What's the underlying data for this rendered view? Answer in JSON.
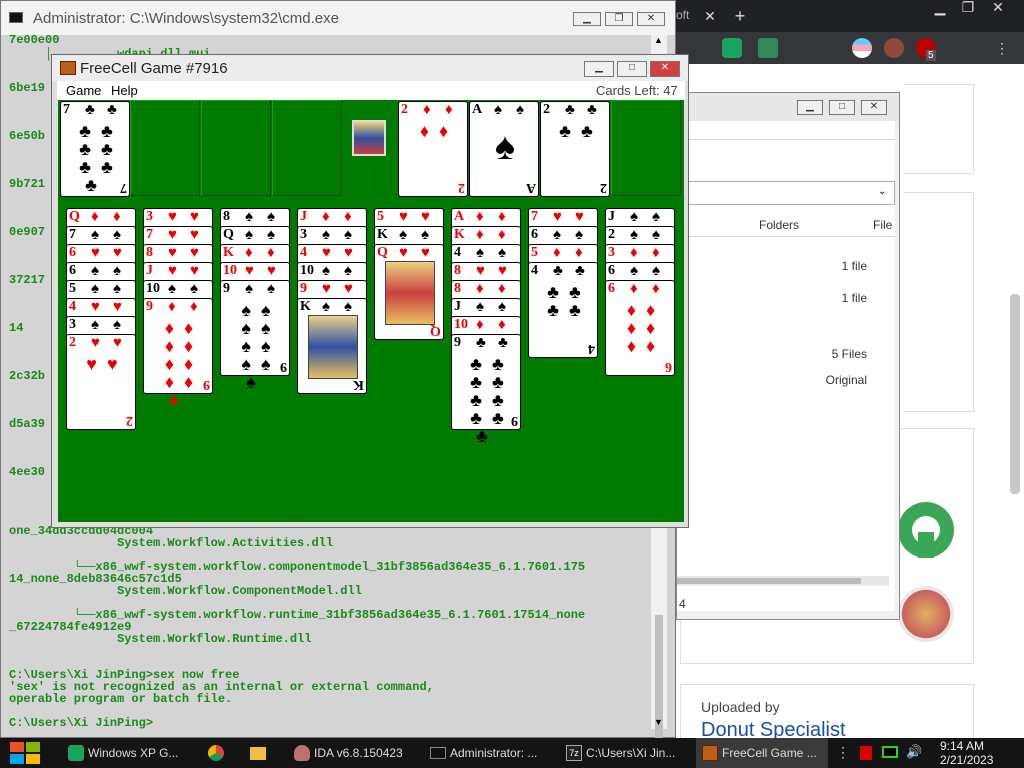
{
  "cmd": {
    "title": "Administrator: C:\\Windows\\system32\\cmd.exe",
    "left_fragments": [
      "7e00e00",
      "6be19",
      "6e50b",
      "9b721",
      "0e907",
      "37217",
      "14",
      "2c32b",
      "d5a39",
      "4ee30"
    ],
    "top_fragment": "     │         wdapi.dll.mui",
    "bottom_lines": [
      "one_34dd3ccdd04dc004",
      "               System.Workflow.Activities.dll",
      "",
      "         └──x86_wwf-system.workflow.componentmodel_31bf3856ad364e35_6.1.7601.175",
      "14_none_8deb83646c57c1d5",
      "               System.Workflow.ComponentModel.dll",
      "",
      "         └──x86_wwf-system.workflow.runtime_31bf3856ad364e35_6.1.7601.17514_none",
      "_67224784fe4912e9",
      "               System.Workflow.Runtime.dll",
      "",
      "",
      "C:\\Users\\Xi JinPing>sex now free",
      "'sex' is not recognized as an internal or external command,",
      "operable program or batch file.",
      "",
      "C:\\Users\\Xi JinPing>"
    ]
  },
  "freecell": {
    "title": "FreeCell Game #7916",
    "menu": [
      "Game",
      "Help"
    ],
    "cards_left": "Cards Left: 47",
    "freecells": [
      {
        "rank": "7",
        "suit": "♣",
        "color": "blk"
      },
      null,
      null,
      null
    ],
    "foundations": [
      {
        "rank": "2",
        "suit": "♦",
        "color": "red"
      },
      {
        "rank": "A",
        "suit": "♠",
        "color": "blk"
      },
      {
        "rank": "2",
        "suit": "♣",
        "color": "blk"
      },
      null
    ],
    "columns": [
      [
        {
          "r": "Q",
          "s": "♦",
          "c": "red"
        },
        {
          "r": "7",
          "s": "♠",
          "c": "blk"
        },
        {
          "r": "6",
          "s": "♥",
          "c": "red"
        },
        {
          "r": "6",
          "s": "♠",
          "c": "blk"
        },
        {
          "r": "5",
          "s": "♠",
          "c": "blk"
        },
        {
          "r": "4",
          "s": "♥",
          "c": "red"
        },
        {
          "r": "3",
          "s": "♠",
          "c": "blk"
        },
        {
          "r": "2",
          "s": "♥",
          "c": "red"
        }
      ],
      [
        {
          "r": "3",
          "s": "♥",
          "c": "red"
        },
        {
          "r": "7",
          "s": "♥",
          "c": "red"
        },
        {
          "r": "8",
          "s": "♥",
          "c": "red"
        },
        {
          "r": "J",
          "s": "♥",
          "c": "red"
        },
        {
          "r": "10",
          "s": "♠",
          "c": "blk"
        },
        {
          "r": "9",
          "s": "♦",
          "c": "red"
        }
      ],
      [
        {
          "r": "8",
          "s": "♠",
          "c": "blk"
        },
        {
          "r": "Q",
          "s": "♠",
          "c": "blk"
        },
        {
          "r": "K",
          "s": "♦",
          "c": "red"
        },
        {
          "r": "10",
          "s": "♥",
          "c": "red"
        },
        {
          "r": "9",
          "s": "♠",
          "c": "blk"
        }
      ],
      [
        {
          "r": "J",
          "s": "♦",
          "c": "red"
        },
        {
          "r": "3",
          "s": "♠",
          "c": "blk"
        },
        {
          "r": "4",
          "s": "♥",
          "c": "red"
        },
        {
          "r": "10",
          "s": "♠",
          "c": "blk"
        },
        {
          "r": "9",
          "s": "♥",
          "c": "red"
        },
        {
          "r": "K",
          "s": "♠",
          "c": "blk"
        }
      ],
      [
        {
          "r": "5",
          "s": "♥",
          "c": "red"
        },
        {
          "r": "K",
          "s": "♠",
          "c": "blk"
        },
        {
          "r": "Q",
          "s": "♥",
          "c": "red"
        }
      ],
      [
        {
          "r": "A",
          "s": "♦",
          "c": "red"
        },
        {
          "r": "K",
          "s": "♦",
          "c": "red"
        },
        {
          "r": "4",
          "s": "♠",
          "c": "blk"
        },
        {
          "r": "8",
          "s": "♥",
          "c": "red"
        },
        {
          "r": "8",
          "s": "♦",
          "c": "red"
        },
        {
          "r": "J",
          "s": "♠",
          "c": "blk"
        },
        {
          "r": "10",
          "s": "♦",
          "c": "red"
        },
        {
          "r": "9",
          "s": "♣",
          "c": "blk"
        }
      ],
      [
        {
          "r": "7",
          "s": "♥",
          "c": "red"
        },
        {
          "r": "6",
          "s": "♠",
          "c": "blk"
        },
        {
          "r": "5",
          "s": "♦",
          "c": "red"
        },
        {
          "r": "4",
          "s": "♣",
          "c": "blk"
        }
      ],
      [
        {
          "r": "J",
          "s": "♠",
          "c": "blk"
        },
        {
          "r": "2",
          "s": "♠",
          "c": "blk"
        },
        {
          "r": "3",
          "s": "♦",
          "c": "red"
        },
        {
          "r": "6",
          "s": "♠",
          "c": "blk"
        },
        {
          "r": "6",
          "s": "♦",
          "c": "red"
        }
      ]
    ]
  },
  "browser": {
    "tab_fragment": "oft",
    "badge": "5",
    "explorer_headers": [
      "Folders",
      "File"
    ],
    "explorer_rows": [
      "1 file",
      "1 file",
      "5 Files",
      "Original"
    ],
    "explorer_footer": "4",
    "uploaded_by": "Uploaded by",
    "uploader": "Donut Specialist"
  },
  "taskbar": {
    "items": [
      "Windows XP G...",
      "",
      "",
      "IDA v6.8.150423",
      "Administrator: ...",
      "C:\\Users\\Xi Jin...",
      "FreeCell Game ..."
    ],
    "time": "9:14 AM",
    "date": "2/21/2023"
  }
}
